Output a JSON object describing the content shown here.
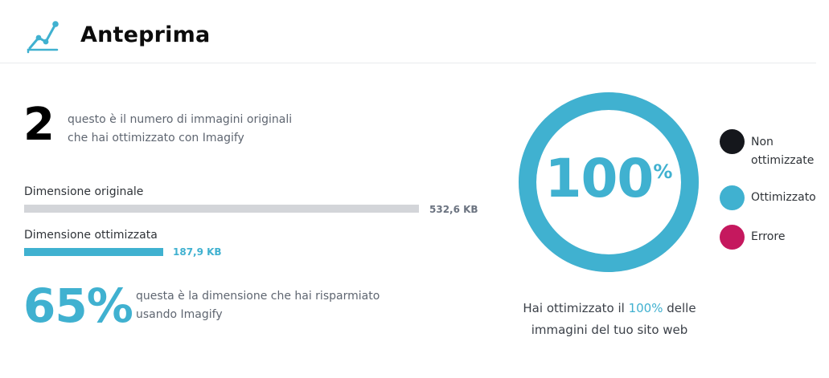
{
  "header": {
    "title": "Anteprima",
    "icon": "chart-line-icon"
  },
  "summary": {
    "count": "2",
    "count_desc_line1": "questo è il numero di immagini originali",
    "count_desc_line2": "che hai ottimizzato con Imagify"
  },
  "sizes": {
    "original_label": "Dimensione originale",
    "original_value": "532,6 KB",
    "optimized_label": "Dimensione ottimizzata",
    "optimized_value": "187,9 KB",
    "optimized_ratio": 0.353
  },
  "saving": {
    "percent": "65%",
    "desc_line1": "questa è la dimensione che hai risparmiato",
    "desc_line2": "usando Imagify"
  },
  "ring": {
    "value": "100",
    "suffix": "%",
    "caption_prefix": "Hai ottimizzato il",
    "caption_highlight": "100%",
    "caption_suffix": "delle",
    "caption_line2": "immagini del tuo sito web",
    "optimized_fraction": 1.0
  },
  "legend": [
    {
      "label_line1": "Non",
      "label_line2": "ottimizzate",
      "color": "#15171c"
    },
    {
      "label_line1": "Ottimizzato",
      "label_line2": "",
      "color": "#40b1d0"
    },
    {
      "label_line1": "Errore",
      "label_line2": "",
      "color": "#c5185e"
    }
  ],
  "colors": {
    "accent": "#40b1d0",
    "dark": "#15171c",
    "error": "#c5185e",
    "track": "#d3d5d9"
  }
}
